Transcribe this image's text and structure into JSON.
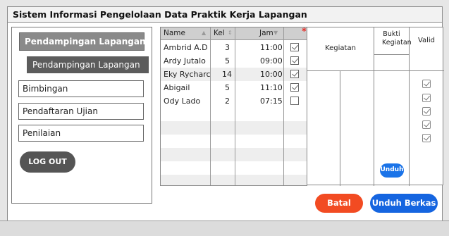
{
  "window": {
    "title": "Sistem Informasi Pengelolaan Data Praktik Kerja Lapangan"
  },
  "sidebar": {
    "header": "Pendampingan Lapangan",
    "submenu": "Pendampingan Lapangan",
    "items": [
      {
        "label": "Bimbingan"
      },
      {
        "label": "Pendaftaran Ujian"
      },
      {
        "label": "Penilaian"
      }
    ],
    "logout": "LOG OUT"
  },
  "table": {
    "columns": [
      "Name",
      "Kel",
      "Jam"
    ],
    "rows": [
      {
        "name": "Ambrid A.D",
        "kel": "3",
        "jam": "11:00",
        "checked": true
      },
      {
        "name": "Ardy Jutalo",
        "kel": "5",
        "jam": "09:00",
        "checked": true
      },
      {
        "name": "Eky Rycharc",
        "kel": "14",
        "jam": "10:00",
        "checked": true
      },
      {
        "name": "Abigail",
        "kel": "5",
        "jam": "11:10",
        "checked": true
      },
      {
        "name": "Ody Lado",
        "kel": "2",
        "jam": "07:15",
        "checked": false
      }
    ]
  },
  "kegiatan": {
    "col_kegiatan": "Kegiatan",
    "col_bukti": "Bukti Kegiatan",
    "col_valid": "Valid",
    "valid_checks": [
      true,
      true,
      true,
      true,
      true
    ],
    "unduh_label": "Unduh"
  },
  "actions": {
    "cancel": "Batal",
    "download": "Unduh Berkas"
  },
  "colors": {
    "cancel": "#f24b22",
    "download": "#1565e0",
    "logout": "#555555"
  }
}
